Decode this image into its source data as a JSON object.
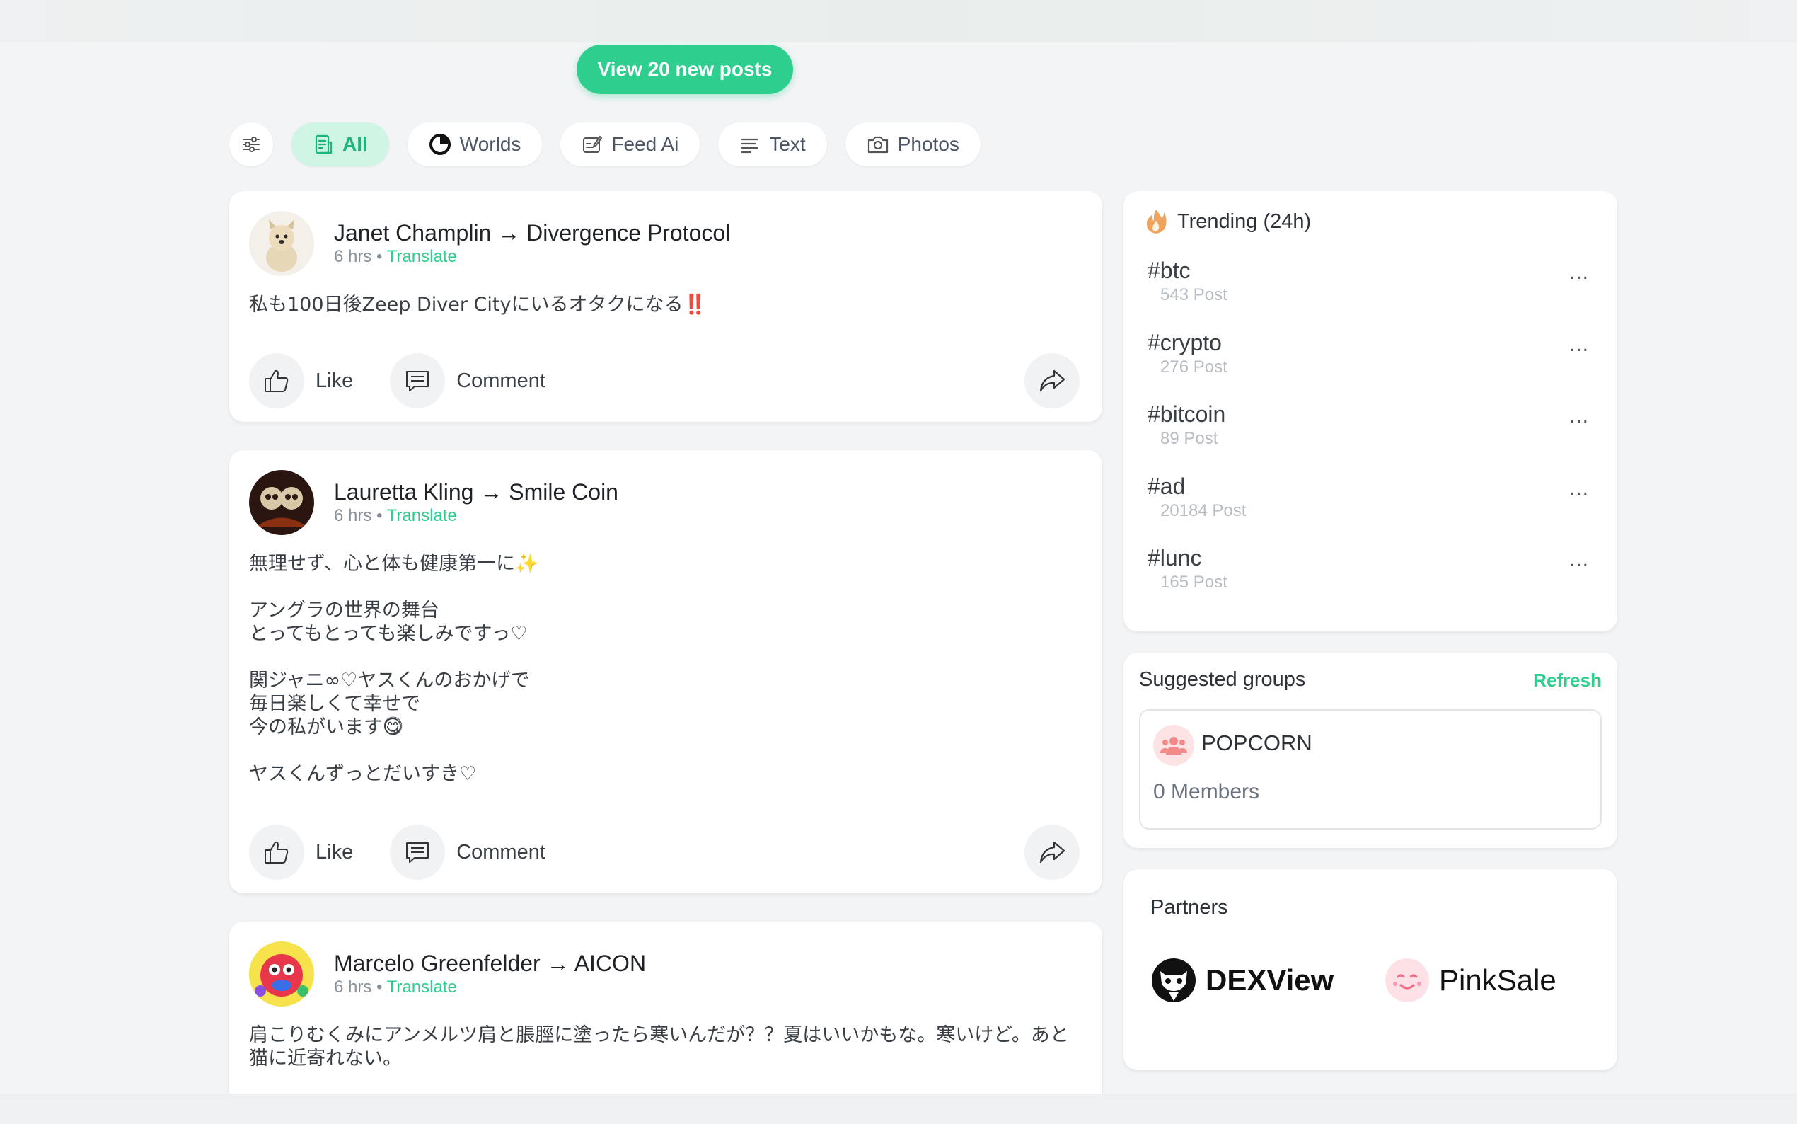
{
  "new_posts_label": "View 20 new posts",
  "filters": [
    {
      "label": "All",
      "icon": "document-icon",
      "active": true
    },
    {
      "label": "Worlds",
      "icon": "worlds-icon",
      "active": false
    },
    {
      "label": "Feed Ai",
      "icon": "edit-feed-icon",
      "active": false
    },
    {
      "label": "Text",
      "icon": "text-lines-icon",
      "active": false
    },
    {
      "label": "Photos",
      "icon": "camera-icon",
      "active": false
    }
  ],
  "posts": [
    {
      "author": "Janet Champlin",
      "arrow": "→",
      "target": "Divergence Protocol",
      "time": "6 hrs",
      "sep": "•",
      "translate": "Translate",
      "body": "私も100日後Zeep Diver Cityにいるオタクになる‼️",
      "like": "Like",
      "comment": "Comment"
    },
    {
      "author": "Lauretta Kling",
      "arrow": "→",
      "target": "Smile Coin",
      "time": "6 hrs",
      "sep": "•",
      "translate": "Translate",
      "body": "無理せず、心と体も健康第一に✨\n\nアングラの世界の舞台\nとってもとっても楽しみですっ♡\n\n関ジャニ∞♡ヤスくんのおかげで\n毎日楽しくて幸せで\n今の私がいます😋⃝\n\nヤスくんずっとだいすき♡",
      "like": "Like",
      "comment": "Comment"
    },
    {
      "author": "Marcelo Greenfelder",
      "arrow": "→",
      "target": "AICON",
      "time": "6 hrs",
      "sep": "•",
      "translate": "Translate",
      "body": "肩こりむくみにアンメルツ肩と脹脛に塗ったら寒いんだが？？夏はいいかもな。寒いけど。あと猫に近寄れない。"
    }
  ],
  "trending": {
    "title": "Trending (24h)",
    "more": "...",
    "items": [
      {
        "tag": "#btc",
        "count": "543 Post"
      },
      {
        "tag": "#crypto",
        "count": "276 Post"
      },
      {
        "tag": "#bitcoin",
        "count": "89 Post"
      },
      {
        "tag": "#ad",
        "count": "20184 Post"
      },
      {
        "tag": "#lunc",
        "count": "165 Post"
      }
    ]
  },
  "suggested_groups": {
    "title": "Suggested groups",
    "refresh": "Refresh",
    "group_name": "POPCORN",
    "members": "0 Members"
  },
  "partners": {
    "title": "Partners",
    "items": [
      "DEXView",
      "PinkSale"
    ]
  },
  "colors": {
    "accent": "#2ecf8e",
    "chip_active_bg": "#cff5e4",
    "page_bg": "#f3f4f6"
  }
}
